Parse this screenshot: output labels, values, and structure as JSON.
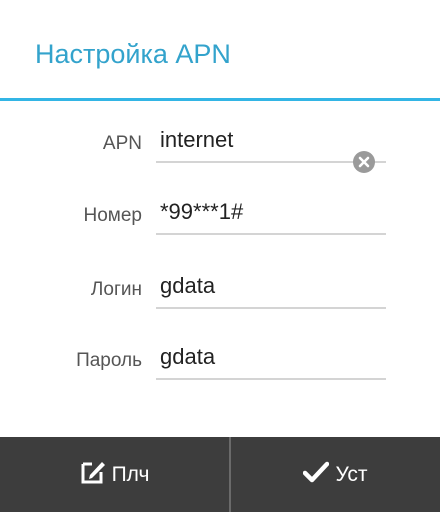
{
  "dialog": {
    "title": "Настройка APN",
    "accent_color": "#33b5e5"
  },
  "fields": [
    {
      "label": "APN",
      "value": "internet",
      "has_clear_icon": true
    },
    {
      "label": "Номер",
      "value": "*99***1#"
    },
    {
      "label": "Логин",
      "value": "gdata"
    },
    {
      "label": "Пароль",
      "value": "gdata"
    }
  ],
  "actions": {
    "left": {
      "label": "Плч",
      "icon": "edit-note-icon"
    },
    "right": {
      "label": "Уст",
      "icon": "checkmark-icon"
    },
    "bar_color": "#3d3d3d"
  }
}
